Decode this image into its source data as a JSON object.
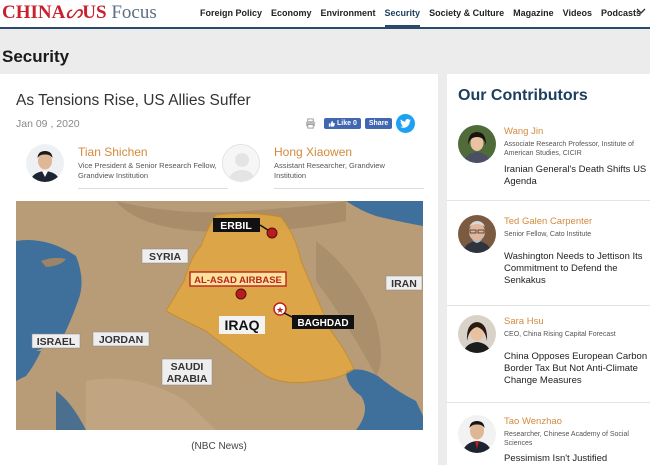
{
  "header": {
    "logo_part1": "CHINA",
    "logo_part2": "US",
    "logo_part3": "Focus",
    "nav": [
      "Foreign Policy",
      "Economy",
      "Environment",
      "Security",
      "Society & Culture",
      "Magazine",
      "Videos",
      "Podcasts"
    ],
    "active_nav": "Security"
  },
  "page": {
    "section_title": "Security"
  },
  "article": {
    "headline": "As Tensions Rise, US Allies Suffer",
    "date": "Jan 09 , 2020",
    "share": {
      "like_label": "Like 0",
      "share_label": "Share"
    },
    "authors": [
      {
        "name": "Tian Shichen",
        "role": "Vice President & Senior Research Fellow, Grandview Institution"
      },
      {
        "name": "Hong Xiaowen",
        "role": "Assistant Researcher, Grandview Institution"
      }
    ],
    "map_labels": {
      "erbil": "ERBIL",
      "syria": "SYRIA",
      "airbase": "AL-ASAD AIRBASE",
      "iraq": "IRAQ",
      "baghdad": "BAGHDAD",
      "iran": "IRAN",
      "israel": "ISRAEL",
      "jordan": "JORDAN",
      "saudi1": "SAUDI",
      "saudi2": "ARABIA"
    },
    "caption": "(NBC News)"
  },
  "sidebar": {
    "title": "Our Contributors",
    "contributors": [
      {
        "name": "Wang Jin",
        "role": "Associate Research Professor, Institute of American Studies, CICIR",
        "article": "Iranian General's Death Shifts US Agenda"
      },
      {
        "name": "Ted Galen Carpenter",
        "role": "Senior Fellow, Cato Institute",
        "article": "Washington Needs to Jettison Its Commitment to Defend the Senkakus"
      },
      {
        "name": "Sara Hsu",
        "role": "CEO, China Rising Capital Forecast",
        "article": "China Opposes European Carbon Border Tax But Not Anti-Climate Change Measures"
      },
      {
        "name": "Tao Wenzhao",
        "role": "Researcher, Chinese Academy of Social Sciences",
        "article": "Pessimism Isn't Justified"
      }
    ]
  },
  "colors": {
    "accent_orange": "#d38a3e",
    "navy": "#1c3d5e",
    "brand_red": "#c8202f",
    "facebook": "#4267b2",
    "twitter": "#1da1f2"
  }
}
